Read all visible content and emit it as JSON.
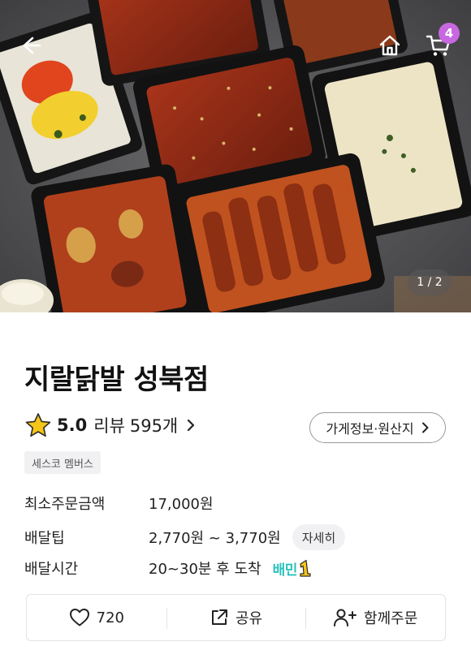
{
  "header": {
    "cart_count": "4",
    "pager": "1 / 2"
  },
  "store": {
    "name": "지랄닭발 성북점",
    "rating": "5.0",
    "review_label": "리뷰",
    "review_count": "595개",
    "info_button": "가게정보·원산지",
    "member_badge": "세스코 멤버스"
  },
  "details": {
    "min_order_label": "최소주문금액",
    "min_order_value": "17,000원",
    "tip_label": "배달팁",
    "tip_value": "2,770원 ~ 3,770원",
    "tip_detail_button": "자세히",
    "time_label": "배달시간",
    "time_value": "20~30분 후 도착",
    "delivery_brand": "배민"
  },
  "actions": {
    "like_count": "720",
    "share_label": "공유",
    "group_order_label": "함께주문"
  },
  "colors": {
    "accent_badge": "#c768e0",
    "baemin_mint": "#2ac1bc",
    "star": "#f5c518"
  }
}
